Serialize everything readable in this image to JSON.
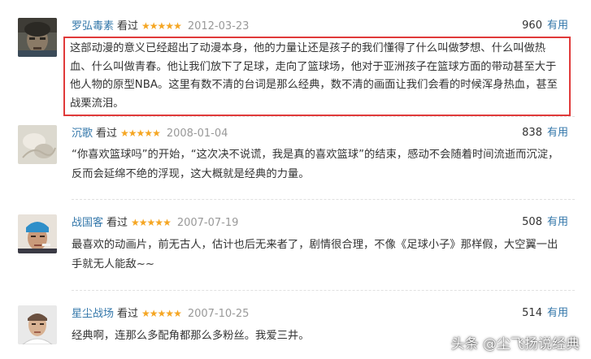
{
  "reviews": [
    {
      "author": "罗弘毒素",
      "status": "看过",
      "stars": "★★★★★",
      "date": "2012-03-23",
      "votes": "960",
      "useful_label": "有用",
      "text": "这部动漫的意义已经超出了动漫本身，他的力量让还是孩子的我们懂得了什么叫做梦想、什么叫做热血、什么叫做青春。他让我们放下了足球，走向了篮球场，他对于亚洲孩子在篮球方面的带动甚至大于他人物的原型NBA。这里有数不清的台词是那么经典，数不清的画面让我们会看的时候浑身热血，甚至战栗流泪。"
    },
    {
      "author": "沉歌",
      "status": "看过",
      "stars": "★★★★★",
      "date": "2008-01-04",
      "votes": "838",
      "useful_label": "有用",
      "text": "“你喜欢篮球吗”的开始，“这次决不说谎，我是真的喜欢篮球”的结束，感动不会随着时间流逝而沉淀，反而会延绵不绝的浮现，这大概就是经典的力量。"
    },
    {
      "author": "战国客",
      "status": "看过",
      "stars": "★★★★★",
      "date": "2007-07-19",
      "votes": "508",
      "useful_label": "有用",
      "text": "最喜欢的动画片，前无古人，估计也后无来者了，剧情很合理，不像《足球小子》那样假，大空翼一出手就无人能敌~~"
    },
    {
      "author": "星尘战场",
      "status": "看过",
      "stars": "★★★★★",
      "date": "2007-10-25",
      "votes": "514",
      "useful_label": "有用",
      "text": "经典啊，连那么多配角都那么多粉丝。我爱三井。"
    }
  ],
  "watermark": "头条 @尘飞扬说经典",
  "colors": {
    "link": "#3377aa",
    "star": "#f5a623",
    "highlight_border": "#e03a3a"
  }
}
